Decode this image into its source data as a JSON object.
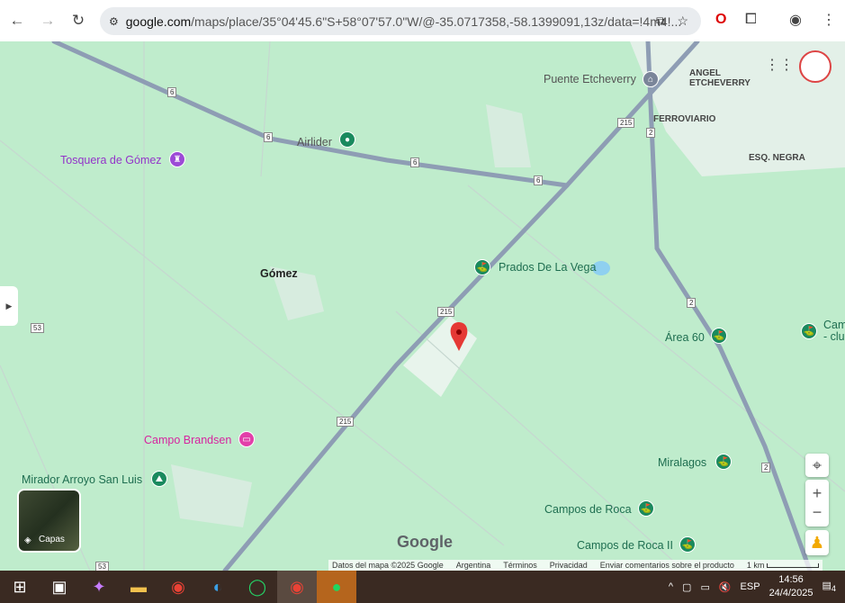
{
  "browser": {
    "url_host": "google.com",
    "url_rest": "/maps/place/35°04'45.6\"S+58°07'57.0\"W/@-35.0717358,-58.1399091,13z/data=!4m4!..."
  },
  "map": {
    "places": [
      {
        "name": "Puente Etcheverry",
        "color": "#555555"
      },
      {
        "name": "Airlider",
        "color": "#555555"
      },
      {
        "name": "Tosquera de Gómez",
        "color": "#9334c9"
      },
      {
        "name": "Gómez",
        "color": "#222222"
      },
      {
        "name": "Prados De La Vega",
        "color": "#1e6e50"
      },
      {
        "name": "Área 60",
        "color": "#1e6e50"
      },
      {
        "name": "Cam\n- clu",
        "color": "#1e6e50"
      },
      {
        "name": "Campo Brandsen",
        "color": "#d6249f"
      },
      {
        "name": "Mirador Arroyo San Luis",
        "color": "#1e6e50"
      },
      {
        "name": "Miralagos",
        "color": "#1e6e50"
      },
      {
        "name": "Campos de Roca",
        "color": "#1e6e50"
      },
      {
        "name": "Campos de Roca II",
        "color": "#1e6e50"
      }
    ],
    "areas": [
      "ANGEL ETCHEVERRY",
      "FERROVIARIO",
      "ESQ. NEGRA"
    ],
    "road_shields": [
      "6",
      "6",
      "6",
      "6",
      "215",
      "215",
      "215",
      "2",
      "2",
      "2",
      "53",
      "53"
    ],
    "layers_label": "Capas",
    "logo": "Google",
    "attribution": {
      "data": "Datos del mapa ©2025 Google",
      "country": "Argentina",
      "terms": "Términos",
      "privacy": "Privacidad",
      "feedback": "Enviar comentarios sobre el producto",
      "scale": "1 km"
    }
  },
  "taskbar": {
    "lang": "ESP",
    "time": "14:56",
    "date": "24/4/2025",
    "notifications": "4"
  }
}
